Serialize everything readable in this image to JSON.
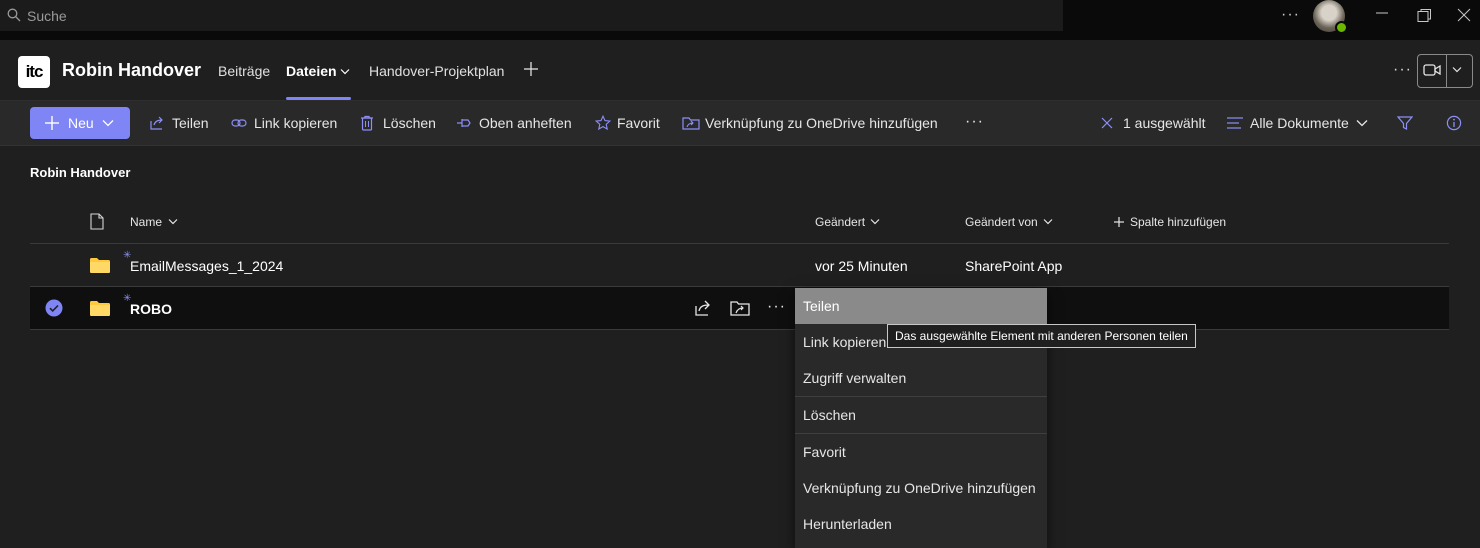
{
  "titlebar": {
    "search_placeholder": "Suche",
    "more": "···"
  },
  "header": {
    "logo_text": "itc",
    "team_name": "Robin Handover",
    "tabs": [
      {
        "label": "Beiträge"
      },
      {
        "label": "Dateien",
        "active": true
      },
      {
        "label": "Handover-Projektplan"
      }
    ],
    "more": "···"
  },
  "commandbar": {
    "new_label": "Neu",
    "actions": [
      {
        "label": "Teilen",
        "icon": "share-icon"
      },
      {
        "label": "Link kopieren",
        "icon": "link-icon"
      },
      {
        "label": "Löschen",
        "icon": "trash-icon"
      },
      {
        "label": "Oben anheften",
        "icon": "pin-icon"
      },
      {
        "label": "Favorit",
        "icon": "star-icon"
      },
      {
        "label": "Verknüpfung zu OneDrive hinzufügen",
        "icon": "shortcut-icon"
      }
    ],
    "more": "···",
    "selection_label": "1 ausgewählt",
    "view_label": "Alle Dokumente"
  },
  "breadcrumb": "Robin Handover",
  "columns": {
    "name": "Name",
    "modified": "Geändert",
    "modified_by": "Geändert von",
    "add_column": "Spalte hinzufügen"
  },
  "rows": [
    {
      "name": "EmailMessages_1_2024",
      "modified": "vor 25 Minuten",
      "modified_by": "SharePoint App",
      "selected": false
    },
    {
      "name": "ROBO",
      "modified": "",
      "modified_by": "",
      "selected": true
    }
  ],
  "row_more": "···",
  "context_menu": [
    "Teilen",
    "Link kopieren",
    "Zugriff verwalten",
    "Löschen",
    "Favorit",
    "Verknüpfung zu OneDrive hinzufügen",
    "Herunterladen"
  ],
  "tooltip": "Das ausgewählte Element mit anderen Personen teilen",
  "colors": {
    "accent": "#7f85f5",
    "folder": "#ffc83d",
    "background": "#1f1f1f"
  }
}
